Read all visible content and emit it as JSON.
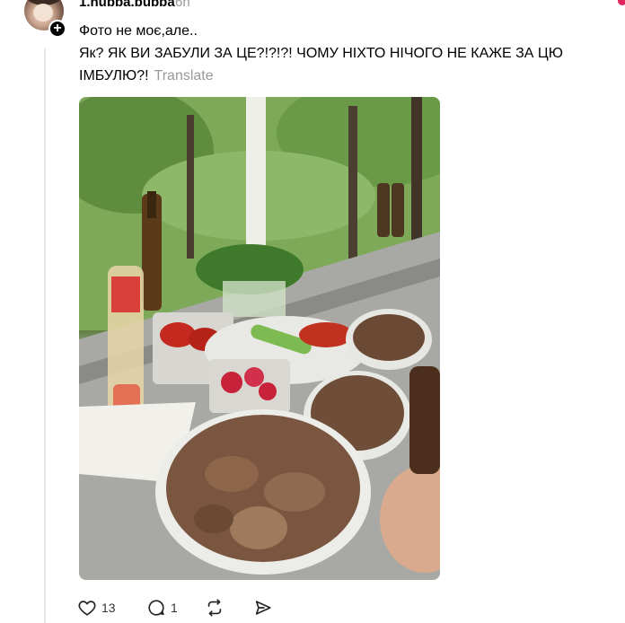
{
  "post": {
    "username": "1.hubba.bubba",
    "time": "6h",
    "text_line1": "Фото не моє,але..",
    "text_line2": "Як? ЯК ВИ ЗАБУЛИ ЗА ЦЕ?!?!?! ЧОМУ НІХТО НІЧОГО НЕ КАЖЕ ЗА ЦЮ",
    "text_line3": "ІМБУЛЮ?!",
    "translate_label": "Translate"
  },
  "actions": {
    "likes": "13",
    "replies": "1"
  },
  "icons": [
    "avatar",
    "plus-icon",
    "heart-icon",
    "comment-icon",
    "repost-icon",
    "share-icon"
  ],
  "colors": {
    "text": "#000000",
    "muted": "#999999",
    "thread_line": "#e5e5e5"
  }
}
